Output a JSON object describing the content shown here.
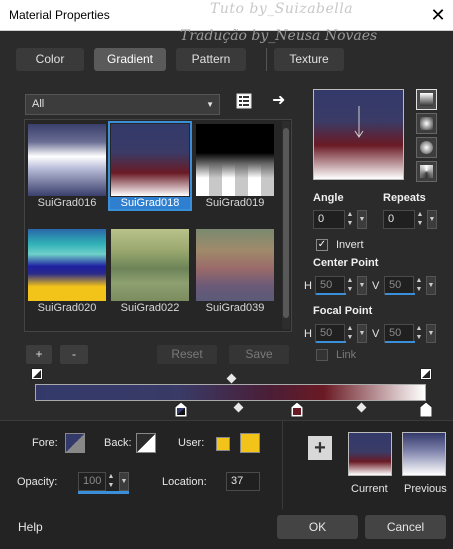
{
  "window": {
    "title": "Material Properties",
    "watermark_top": "Tuto by_Suizabella",
    "watermark_bottom": "Tradução by_Neusa Novaes",
    "close_glyph": "✕"
  },
  "tabs": [
    {
      "label": "Color",
      "active": false
    },
    {
      "label": "Gradient",
      "active": true
    },
    {
      "label": "Pattern",
      "active": false
    },
    {
      "label": "Texture",
      "active": false
    }
  ],
  "library": {
    "selected": "All",
    "chevron": "▼",
    "arrow_glyph": "➜"
  },
  "gradients": [
    {
      "name": "SuiGrad016",
      "selected": false
    },
    {
      "name": "SuiGrad018",
      "selected": true
    },
    {
      "name": "SuiGrad019",
      "selected": false
    },
    {
      "name": "SuiGrad020",
      "selected": false
    },
    {
      "name": "SuiGrad022",
      "selected": false
    },
    {
      "name": "SuiGrad039",
      "selected": false
    }
  ],
  "library_buttons": {
    "add": "+",
    "remove": "-",
    "reset": "Reset",
    "save": "Save"
  },
  "settings": {
    "angle_label": "Angle",
    "angle_value": "0",
    "repeats_label": "Repeats",
    "repeats_value": "0",
    "invert_label": "Invert",
    "invert_checked": true,
    "center_point_label": "Center Point",
    "center_h_label": "H",
    "center_h_value": "50",
    "center_v_label": "V",
    "center_v_value": "50",
    "focal_point_label": "Focal Point",
    "focal_h_label": "H",
    "focal_h_value": "50",
    "focal_v_label": "V",
    "focal_v_value": "50",
    "link_label": "Link",
    "link_checked": false
  },
  "colors": {
    "accent": "#2f7fd1",
    "dark_blue": "#333a6a",
    "dark_red": "#6a1a24",
    "white": "#ffffff",
    "user_yellow": "#f2c318"
  },
  "stop_editor": {
    "fore_label": "Fore:",
    "back_label": "Back:",
    "user_label": "User:",
    "opacity_label": "Opacity:",
    "opacity_value": "100",
    "location_label": "Location:",
    "location_value": "37",
    "add_stop_glyph": "+"
  },
  "preview": {
    "current_label": "Current",
    "previous_label": "Previous"
  },
  "footer": {
    "help": "Help",
    "ok": "OK",
    "cancel": "Cancel"
  }
}
